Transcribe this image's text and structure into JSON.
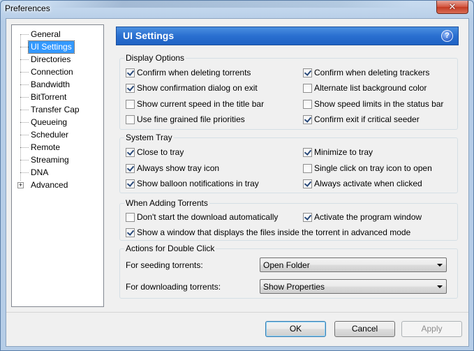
{
  "window": {
    "title": "Preferences",
    "close_glyph": "✕"
  },
  "tree": {
    "items": [
      {
        "label": "General"
      },
      {
        "label": "UI Settings"
      },
      {
        "label": "Directories"
      },
      {
        "label": "Connection"
      },
      {
        "label": "Bandwidth"
      },
      {
        "label": "BitTorrent"
      },
      {
        "label": "Transfer Cap"
      },
      {
        "label": "Queueing"
      },
      {
        "label": "Scheduler"
      },
      {
        "label": "Remote"
      },
      {
        "label": "Streaming"
      },
      {
        "label": "DNA"
      },
      {
        "label": "Advanced",
        "expander": "+"
      }
    ]
  },
  "header": {
    "title": "UI Settings",
    "help_glyph": "?"
  },
  "display_options": {
    "label": "Display Options",
    "items": [
      {
        "label": "Confirm when deleting torrents",
        "checked": true
      },
      {
        "label": "Confirm when deleting trackers",
        "checked": true
      },
      {
        "label": "Show confirmation dialog on exit",
        "checked": true
      },
      {
        "label": "Alternate list background color",
        "checked": false
      },
      {
        "label": "Show current speed in the title bar",
        "checked": false
      },
      {
        "label": "Show speed limits in the status bar",
        "checked": false
      },
      {
        "label": "Use fine grained file priorities",
        "checked": false
      },
      {
        "label": "Confirm exit if critical seeder",
        "checked": true
      }
    ]
  },
  "system_tray": {
    "label": "System Tray",
    "items": [
      {
        "label": "Close to tray",
        "checked": true
      },
      {
        "label": "Minimize to tray",
        "checked": true
      },
      {
        "label": "Always show tray icon",
        "checked": true
      },
      {
        "label": "Single click on tray icon to open",
        "checked": false
      },
      {
        "label": "Show balloon notifications in tray",
        "checked": true
      },
      {
        "label": "Always activate when clicked",
        "checked": true
      }
    ]
  },
  "adding_torrents": {
    "label": "When Adding Torrents",
    "items": [
      {
        "label": "Don't start the download automatically",
        "checked": false
      },
      {
        "label": "Activate the program window",
        "checked": true
      },
      {
        "label": "Show a window that displays the files inside the torrent in advanced mode",
        "checked": true
      }
    ]
  },
  "double_click": {
    "label": "Actions for Double Click",
    "seeding_label": "For seeding torrents:",
    "seeding_value": "Open Folder",
    "downloading_label": "For downloading torrents:",
    "downloading_value": "Show Properties"
  },
  "buttons": {
    "ok": "OK",
    "cancel": "Cancel",
    "apply": "Apply"
  }
}
